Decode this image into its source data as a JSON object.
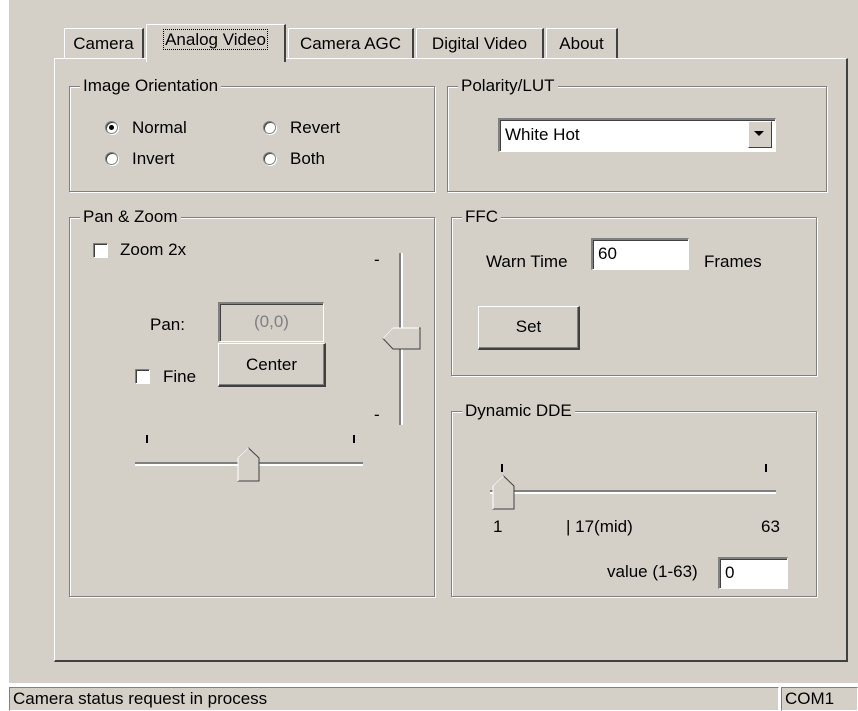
{
  "tabs": [
    "Camera",
    "Analog Video",
    "Camera AGC",
    "Digital Video",
    "About"
  ],
  "image_orientation": {
    "title": "Image Orientation",
    "options": [
      "Normal",
      "Revert",
      "Invert",
      "Both"
    ],
    "selected": "Normal"
  },
  "polarity": {
    "title": "Polarity/LUT",
    "selected": "White Hot"
  },
  "pan_zoom": {
    "title": "Pan & Zoom",
    "zoom_label": "Zoom 2x",
    "zoom_checked": false,
    "pan_label": "Pan:",
    "pan_value": "(0,0)",
    "center_label": "Center",
    "fine_label": "Fine",
    "fine_checked": false,
    "v_slider_min_label": "-",
    "v_slider_max_label": "-",
    "v_slider_level": 0.5,
    "h_slider_level": 0.5
  },
  "ffc": {
    "title": "FFC",
    "warn_label": "Warn Time",
    "warn_value": "60",
    "frames_label": "Frames",
    "set_label": "Set"
  },
  "dde": {
    "title": "Dynamic DDE",
    "min_label": "1",
    "mid_label": "| 17(mid)",
    "max_label": "63",
    "value_label": "value (1-63)",
    "value": "0",
    "slider_value": 1,
    "slider_min": 1,
    "slider_max": 63
  },
  "status": {
    "message": "Camera status request in process",
    "port": "COM1"
  },
  "colors": {
    "face": "#d4d0c8",
    "shadow": "#808080",
    "dark": "#404040",
    "highlight": "#ffffff"
  }
}
